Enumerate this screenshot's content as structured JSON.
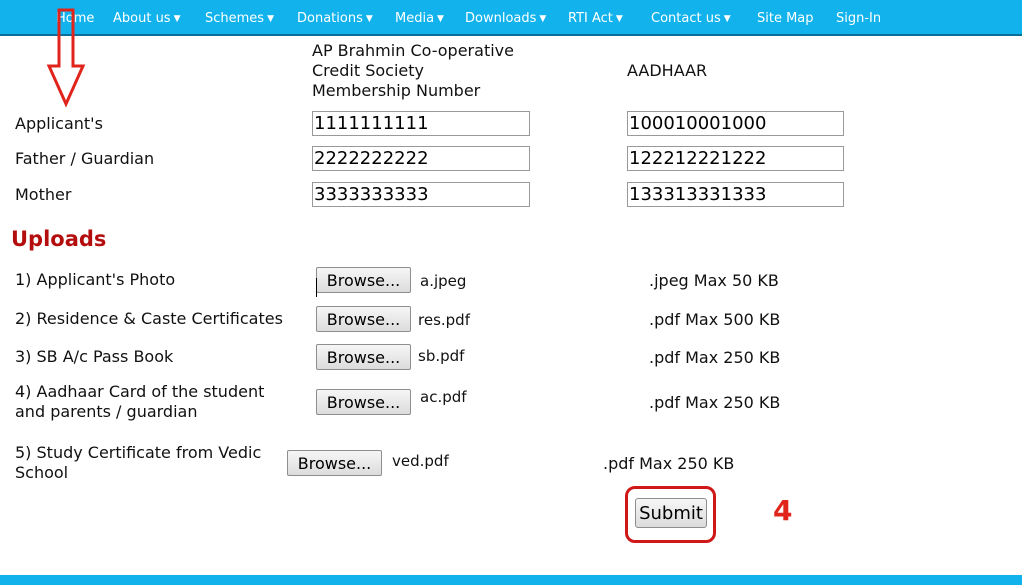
{
  "nav": {
    "items": [
      {
        "label": "Home",
        "caret": false
      },
      {
        "label": "About us",
        "caret": true
      },
      {
        "label": "Schemes",
        "caret": true
      },
      {
        "label": "Donations",
        "caret": true
      },
      {
        "label": "Media",
        "caret": true
      },
      {
        "label": "Downloads",
        "caret": true
      },
      {
        "label": "RTI Act",
        "caret": true
      },
      {
        "label": "Contact us",
        "caret": true
      },
      {
        "label": "Site Map",
        "caret": false
      },
      {
        "label": "Sign-In",
        "caret": false
      }
    ],
    "caret_glyph": "▼"
  },
  "form": {
    "col_membership_header": [
      "AP Brahmin Co-operative",
      "Credit Society",
      "Membership Number"
    ],
    "col_aadhaar_header": "AADHAAR",
    "rows": [
      {
        "label": "Applicant's",
        "membership": "1111111111",
        "aadhaar": "100010001000"
      },
      {
        "label": "Father / Guardian",
        "membership": "2222222222",
        "aadhaar": "122212221222"
      },
      {
        "label": "Mother",
        "membership": "3333333333",
        "aadhaar": "133313331333"
      }
    ]
  },
  "uploads": {
    "heading": "Uploads",
    "browse_label": "Browse...",
    "items": [
      {
        "label": [
          "1) Applicant's Photo"
        ],
        "file": "a.jpeg",
        "limit": ".jpeg Max 50 KB"
      },
      {
        "label": [
          "2) Residence  & Caste Certificates"
        ],
        "file": "res.pdf",
        "limit": ".pdf Max 500 KB"
      },
      {
        "label": [
          "3) SB A/c Pass Book"
        ],
        "file": "sb.pdf",
        "limit": ".pdf Max 250 KB"
      },
      {
        "label": [
          "4) Aadhaar Card of the student",
          "and parents / guardian"
        ],
        "file": "ac.pdf",
        "limit": ".pdf Max 250 KB"
      },
      {
        "label": [
          "5) Study Certificate from Vedic",
          "School"
        ],
        "file": "ved.pdf",
        "limit": ".pdf Max 250 KB"
      }
    ]
  },
  "submit_label": "Submit",
  "annotation": {
    "step_number": "4",
    "color": "#e0241b",
    "arrow_icon": "down-arrow-icon"
  },
  "colors": {
    "nav_bg": "#12b3ec",
    "heading_red": "#b40d0d"
  }
}
